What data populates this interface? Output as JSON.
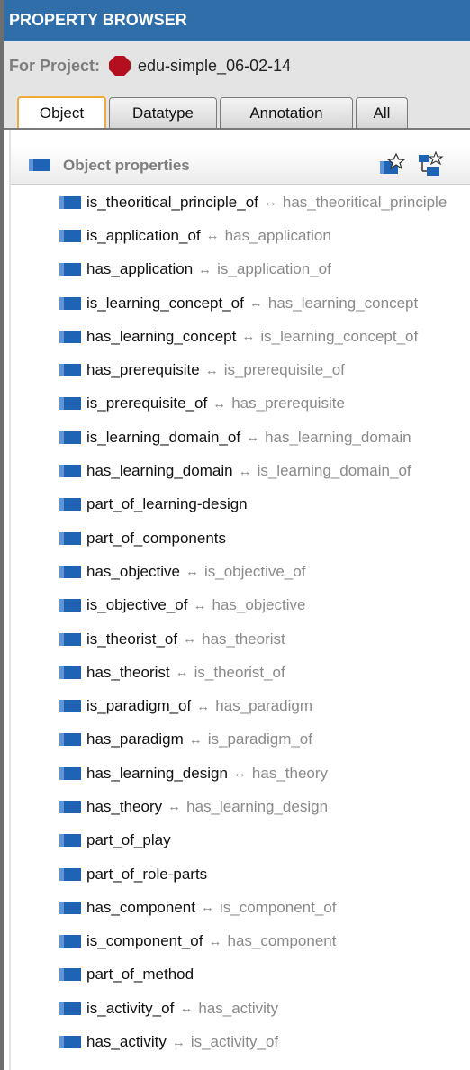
{
  "browser": {
    "title": "PROPERTY BROWSER"
  },
  "project": {
    "label": "For Project:",
    "name": "edu-simple_06-02-14",
    "icon": "ontology-project-icon"
  },
  "tabs": [
    {
      "label": "Object",
      "active": true
    },
    {
      "label": "Datatype",
      "active": false
    },
    {
      "label": "Annotation",
      "active": false
    },
    {
      "label": "All",
      "active": false
    }
  ],
  "section": {
    "title": "Object properties",
    "tools": [
      "create-property-icon",
      "create-subproperty-icon"
    ]
  },
  "arrow_glyph": "↔",
  "colors": {
    "header_bg": "#2f6ea9",
    "property_icon": "#1f63b5",
    "tab_active_border": "#f0a93b",
    "project_icon": "#b40f1e"
  },
  "properties": [
    {
      "name": "is_theoritical_principle_of",
      "inverse": "has_theoritical_principle"
    },
    {
      "name": "is_application_of",
      "inverse": "has_application"
    },
    {
      "name": "has_application",
      "inverse": "is_application_of"
    },
    {
      "name": "is_learning_concept_of",
      "inverse": "has_learning_concept"
    },
    {
      "name": "has_learning_concept",
      "inverse": "is_learning_concept_of"
    },
    {
      "name": "has_prerequisite",
      "inverse": "is_prerequisite_of"
    },
    {
      "name": "is_prerequisite_of",
      "inverse": "has_prerequisite"
    },
    {
      "name": "is_learning_domain_of",
      "inverse": "has_learning_domain"
    },
    {
      "name": "has_learning_domain",
      "inverse": "is_learning_domain_of"
    },
    {
      "name": "part_of_learning-design",
      "inverse": ""
    },
    {
      "name": "part_of_components",
      "inverse": ""
    },
    {
      "name": "has_objective",
      "inverse": "is_objective_of"
    },
    {
      "name": "is_objective_of",
      "inverse": "has_objective"
    },
    {
      "name": "is_theorist_of",
      "inverse": "has_theorist"
    },
    {
      "name": "has_theorist",
      "inverse": "is_theorist_of"
    },
    {
      "name": "is_paradigm_of",
      "inverse": "has_paradigm"
    },
    {
      "name": "has_paradigm",
      "inverse": "is_paradigm_of"
    },
    {
      "name": "has_learning_design",
      "inverse": "has_theory"
    },
    {
      "name": "has_theory",
      "inverse": "has_learning_design"
    },
    {
      "name": "part_of_play",
      "inverse": ""
    },
    {
      "name": "part_of_role-parts",
      "inverse": ""
    },
    {
      "name": "has_component",
      "inverse": "is_component_of"
    },
    {
      "name": "is_component_of",
      "inverse": "has_component"
    },
    {
      "name": "part_of_method",
      "inverse": ""
    },
    {
      "name": "is_activity_of",
      "inverse": "has_activity"
    },
    {
      "name": "has_activity",
      "inverse": "is_activity_of"
    }
  ]
}
